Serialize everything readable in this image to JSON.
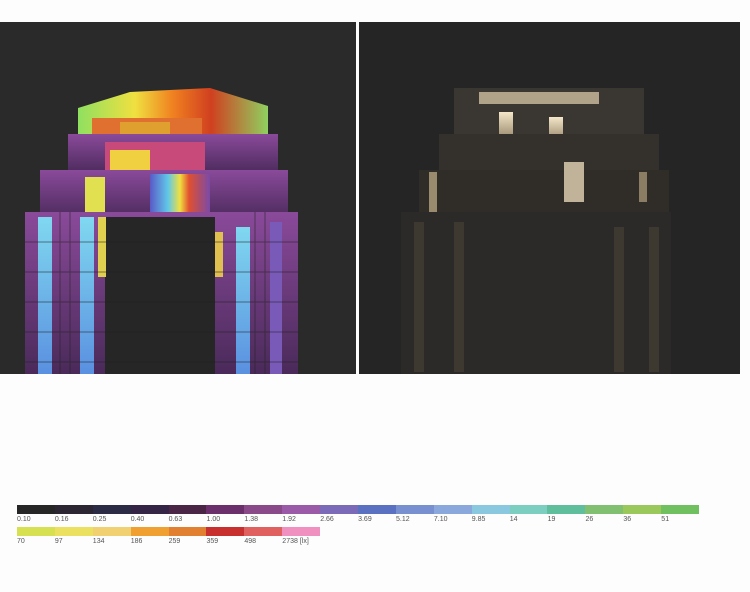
{
  "legend": {
    "row1": [
      {
        "label": "0.10",
        "color": "#262626"
      },
      {
        "label": "0.16",
        "color": "#2c2532"
      },
      {
        "label": "0.25",
        "color": "#2b2b46"
      },
      {
        "label": "0.40",
        "color": "#342546"
      },
      {
        "label": "0.63",
        "color": "#4a2546"
      },
      {
        "label": "1.00",
        "color": "#6b2f6b"
      },
      {
        "label": "1.38",
        "color": "#8a4a8a"
      },
      {
        "label": "1.92",
        "color": "#9a5aa8"
      },
      {
        "label": "2.66",
        "color": "#7a6ab8"
      },
      {
        "label": "3.69",
        "color": "#5a70c0"
      },
      {
        "label": "5.12",
        "color": "#7890d0"
      },
      {
        "label": "7.10",
        "color": "#8aa8dc"
      },
      {
        "label": "9.85",
        "color": "#8ac8e0"
      },
      {
        "label": "14",
        "color": "#7ccfc0"
      },
      {
        "label": "19",
        "color": "#5fbf9c"
      },
      {
        "label": "26",
        "color": "#80c070"
      },
      {
        "label": "36",
        "color": "#9ac85a"
      },
      {
        "label": "51",
        "color": "#70c060"
      }
    ],
    "row2": [
      {
        "label": "70",
        "color": "#d6e050"
      },
      {
        "label": "97",
        "color": "#ece060"
      },
      {
        "label": "134",
        "color": "#f0d070"
      },
      {
        "label": "186",
        "color": "#f0a030"
      },
      {
        "label": "259",
        "color": "#e08030"
      },
      {
        "label": "359",
        "color": "#c83030"
      },
      {
        "label": "498",
        "color": "#e06060"
      },
      {
        "label": "2738 [lx]",
        "color": "#f090c0"
      }
    ]
  }
}
